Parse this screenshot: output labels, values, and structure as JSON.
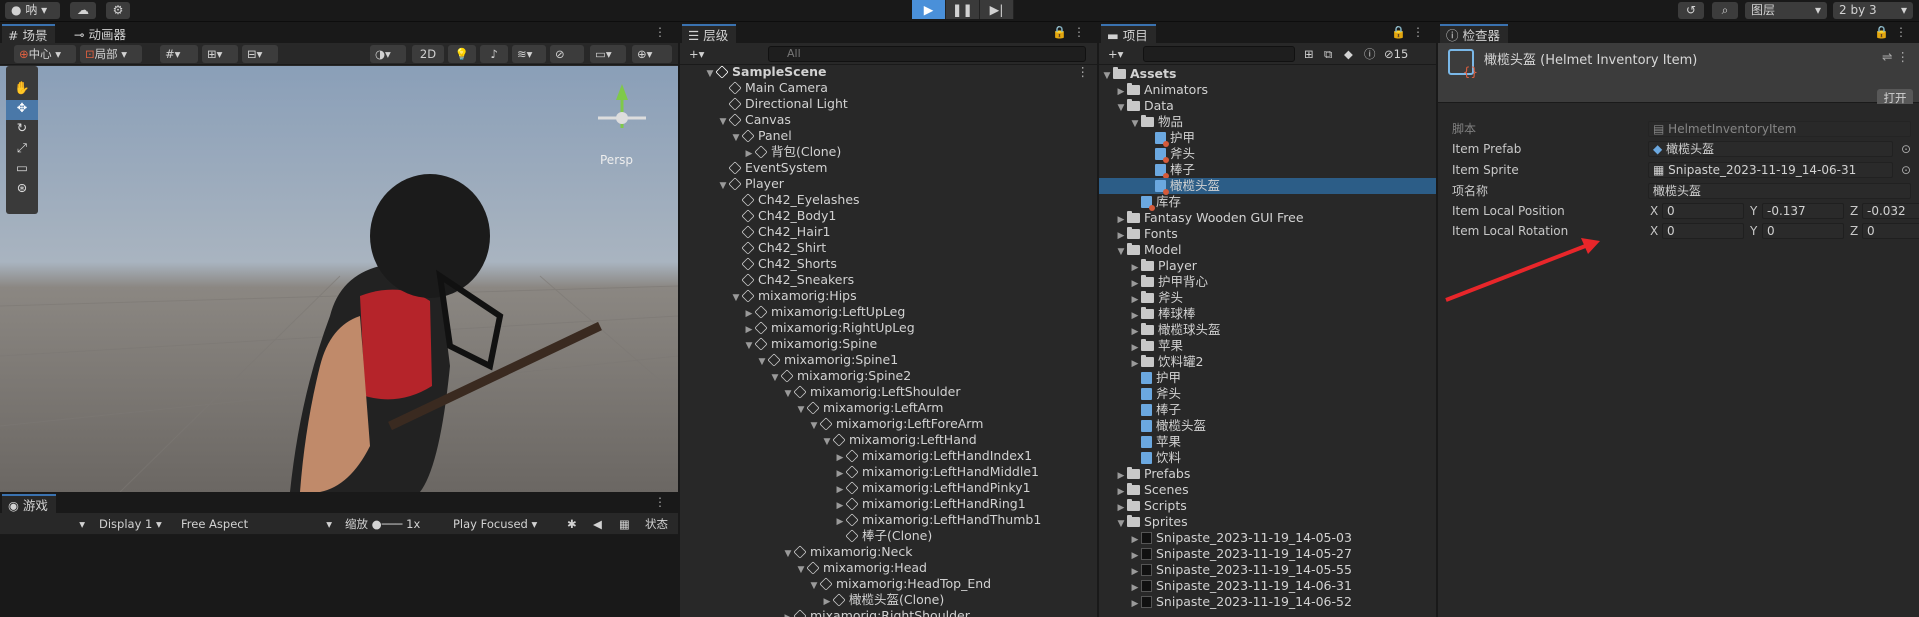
{
  "topbar": {
    "account": "呐",
    "layers": "图层",
    "layout": "2 by 3"
  },
  "scene": {
    "tabs": [
      "场景",
      "动画器"
    ],
    "pivot": "中心",
    "space": "局部",
    "btn_2d": "2D",
    "persp": "Persp"
  },
  "game": {
    "tab": "游戏",
    "display": "Display 1",
    "aspect": "Free Aspect",
    "scale_label": "缩放",
    "scale_value": "1x",
    "play_mode": "Play Focused",
    "stats": "状态"
  },
  "hierarchy": {
    "tab": "层级",
    "search_placeholder": "All",
    "rows": [
      {
        "label": "SampleScene",
        "indent": 0,
        "fold": "▼",
        "bold": true,
        "icon": "unity"
      },
      {
        "label": "Main Camera",
        "indent": 1,
        "fold": "",
        "icon": "cube"
      },
      {
        "label": "Directional Light",
        "indent": 1,
        "fold": "",
        "icon": "cube"
      },
      {
        "label": "Canvas",
        "indent": 1,
        "fold": "▼",
        "icon": "cube"
      },
      {
        "label": "Panel",
        "indent": 2,
        "fold": "▼",
        "icon": "cube"
      },
      {
        "label": "背包(Clone)",
        "indent": 3,
        "fold": "▶",
        "icon": "cube"
      },
      {
        "label": "EventSystem",
        "indent": 1,
        "fold": "",
        "icon": "cube"
      },
      {
        "label": "Player",
        "indent": 1,
        "fold": "▼",
        "icon": "cube"
      },
      {
        "label": "Ch42_Eyelashes",
        "indent": 2,
        "fold": "",
        "icon": "cube"
      },
      {
        "label": "Ch42_Body1",
        "indent": 2,
        "fold": "",
        "icon": "cube"
      },
      {
        "label": "Ch42_Hair1",
        "indent": 2,
        "fold": "",
        "icon": "cube"
      },
      {
        "label": "Ch42_Shirt",
        "indent": 2,
        "fold": "",
        "icon": "cube"
      },
      {
        "label": "Ch42_Shorts",
        "indent": 2,
        "fold": "",
        "icon": "cube"
      },
      {
        "label": "Ch42_Sneakers",
        "indent": 2,
        "fold": "",
        "icon": "cube"
      },
      {
        "label": "mixamorig:Hips",
        "indent": 2,
        "fold": "▼",
        "icon": "cube"
      },
      {
        "label": "mixamorig:LeftUpLeg",
        "indent": 3,
        "fold": "▶",
        "icon": "cube"
      },
      {
        "label": "mixamorig:RightUpLeg",
        "indent": 3,
        "fold": "▶",
        "icon": "cube"
      },
      {
        "label": "mixamorig:Spine",
        "indent": 3,
        "fold": "▼",
        "icon": "cube"
      },
      {
        "label": "mixamorig:Spine1",
        "indent": 4,
        "fold": "▼",
        "icon": "cube"
      },
      {
        "label": "mixamorig:Spine2",
        "indent": 5,
        "fold": "▼",
        "icon": "cube"
      },
      {
        "label": "mixamorig:LeftShoulder",
        "indent": 6,
        "fold": "▼",
        "icon": "cube"
      },
      {
        "label": "mixamorig:LeftArm",
        "indent": 7,
        "fold": "▼",
        "icon": "cube"
      },
      {
        "label": "mixamorig:LeftForeArm",
        "indent": 8,
        "fold": "▼",
        "icon": "cube"
      },
      {
        "label": "mixamorig:LeftHand",
        "indent": 9,
        "fold": "▼",
        "icon": "cube"
      },
      {
        "label": "mixamorig:LeftHandIndex1",
        "indent": 10,
        "fold": "▶",
        "icon": "cube"
      },
      {
        "label": "mixamorig:LeftHandMiddle1",
        "indent": 10,
        "fold": "▶",
        "icon": "cube"
      },
      {
        "label": "mixamorig:LeftHandPinky1",
        "indent": 10,
        "fold": "▶",
        "icon": "cube"
      },
      {
        "label": "mixamorig:LeftHandRing1",
        "indent": 10,
        "fold": "▶",
        "icon": "cube"
      },
      {
        "label": "mixamorig:LeftHandThumb1",
        "indent": 10,
        "fold": "▶",
        "icon": "cube"
      },
      {
        "label": "棒子(Clone)",
        "indent": 10,
        "fold": "",
        "icon": "cube"
      },
      {
        "label": "mixamorig:Neck",
        "indent": 6,
        "fold": "▼",
        "icon": "cube"
      },
      {
        "label": "mixamorig:Head",
        "indent": 7,
        "fold": "▼",
        "icon": "cube"
      },
      {
        "label": "mixamorig:HeadTop_End",
        "indent": 8,
        "fold": "▼",
        "icon": "cube"
      },
      {
        "label": "橄榄头盔(Clone)",
        "indent": 9,
        "fold": "▶",
        "icon": "cube"
      },
      {
        "label": "mixamorig:RightShoulder",
        "indent": 6,
        "fold": "▶",
        "icon": "cube"
      }
    ]
  },
  "project": {
    "tab": "项目",
    "hidden_count": "15",
    "rows": [
      {
        "label": "Assets",
        "indent": 0,
        "fold": "▼",
        "icon": "folder",
        "bold": true
      },
      {
        "label": "Animators",
        "indent": 1,
        "fold": "▶",
        "icon": "folder"
      },
      {
        "label": "Data",
        "indent": 1,
        "fold": "▼",
        "icon": "folder"
      },
      {
        "label": "物品",
        "indent": 2,
        "fold": "▼",
        "icon": "folder"
      },
      {
        "label": "护甲",
        "indent": 3,
        "fold": "",
        "icon": "so"
      },
      {
        "label": "斧头",
        "indent": 3,
        "fold": "",
        "icon": "so"
      },
      {
        "label": "棒子",
        "indent": 3,
        "fold": "",
        "icon": "so"
      },
      {
        "label": "橄榄头盔",
        "indent": 3,
        "fold": "",
        "icon": "so",
        "selected": true
      },
      {
        "label": "库存",
        "indent": 2,
        "fold": "",
        "icon": "so"
      },
      {
        "label": "Fantasy Wooden GUI  Free",
        "indent": 1,
        "fold": "▶",
        "icon": "folder"
      },
      {
        "label": "Fonts",
        "indent": 1,
        "fold": "▶",
        "icon": "folder"
      },
      {
        "label": "Model",
        "indent": 1,
        "fold": "▼",
        "icon": "folder"
      },
      {
        "label": "Player",
        "indent": 2,
        "fold": "▶",
        "icon": "folder"
      },
      {
        "label": "护甲背心",
        "indent": 2,
        "fold": "▶",
        "icon": "folder"
      },
      {
        "label": "斧头",
        "indent": 2,
        "fold": "▶",
        "icon": "folder"
      },
      {
        "label": "棒球棒",
        "indent": 2,
        "fold": "▶",
        "icon": "folder"
      },
      {
        "label": "橄榄球头盔",
        "indent": 2,
        "fold": "▶",
        "icon": "folder"
      },
      {
        "label": "苹果",
        "indent": 2,
        "fold": "▶",
        "icon": "folder"
      },
      {
        "label": "饮料罐2",
        "indent": 2,
        "fold": "▶",
        "icon": "folder"
      },
      {
        "label": "护甲",
        "indent": 2,
        "fold": "",
        "icon": "prefab"
      },
      {
        "label": "斧头",
        "indent": 2,
        "fold": "",
        "icon": "prefab"
      },
      {
        "label": "棒子",
        "indent": 2,
        "fold": "",
        "icon": "prefab"
      },
      {
        "label": "橄榄头盔",
        "indent": 2,
        "fold": "",
        "icon": "prefab"
      },
      {
        "label": "苹果",
        "indent": 2,
        "fold": "",
        "icon": "prefab"
      },
      {
        "label": "饮料",
        "indent": 2,
        "fold": "",
        "icon": "prefab"
      },
      {
        "label": "Prefabs",
        "indent": 1,
        "fold": "▶",
        "icon": "folder"
      },
      {
        "label": "Scenes",
        "indent": 1,
        "fold": "▶",
        "icon": "folder"
      },
      {
        "label": "Scripts",
        "indent": 1,
        "fold": "▶",
        "icon": "folder"
      },
      {
        "label": "Sprites",
        "indent": 1,
        "fold": "▼",
        "icon": "folder"
      },
      {
        "label": "Snipaste_2023-11-19_14-05-03",
        "indent": 2,
        "fold": "▶",
        "icon": "sprite"
      },
      {
        "label": "Snipaste_2023-11-19_14-05-27",
        "indent": 2,
        "fold": "▶",
        "icon": "sprite"
      },
      {
        "label": "Snipaste_2023-11-19_14-05-55",
        "indent": 2,
        "fold": "▶",
        "icon": "sprite"
      },
      {
        "label": "Snipaste_2023-11-19_14-06-31",
        "indent": 2,
        "fold": "▶",
        "icon": "sprite"
      },
      {
        "label": "Snipaste_2023-11-19_14-06-52",
        "indent": 2,
        "fold": "▶",
        "icon": "sprite"
      }
    ]
  },
  "inspector": {
    "tab": "检查器",
    "title": "橄榄头盔 (Helmet Inventory Item)",
    "open_button": "打开",
    "script_label": "脚本",
    "script_value": "HelmetInventoryItem",
    "prefab_label": "Item Prefab",
    "prefab_value": "橄榄头盔",
    "sprite_label": "Item Sprite",
    "sprite_value": "Snipaste_2023-11-19_14-06-31",
    "name_label": "项名称",
    "name_value": "橄榄头盔",
    "pos_label": "Item Local Position",
    "pos": {
      "x": "0",
      "y": "-0.137",
      "z": "-0.032"
    },
    "rot_label": "Item Local Rotation",
    "rot": {
      "x": "0",
      "y": "0",
      "z": "0"
    },
    "axis": {
      "x": "X",
      "y": "Y",
      "z": "Z"
    }
  },
  "colors": {
    "accent": "#2c5d87",
    "annotation_arrow": "#e8262a"
  }
}
